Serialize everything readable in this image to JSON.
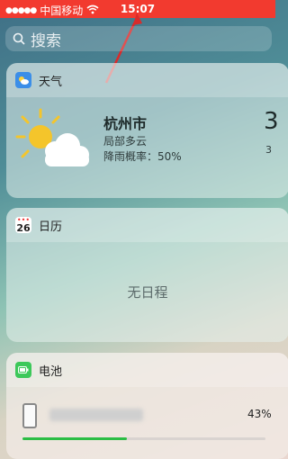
{
  "status_bar": {
    "carrier": "中国移动",
    "time": "15:07"
  },
  "search": {
    "label": "搜索"
  },
  "weather_widget": {
    "title": "天气",
    "city": "杭州市",
    "condition": "局部多云",
    "rain_chance": "降雨概率：50%",
    "temp_partial": "3",
    "temp_small_partial": "3"
  },
  "calendar_widget": {
    "title": "日历",
    "icon_date": "26",
    "empty_text": "无日程"
  },
  "battery_widget": {
    "title": "电池",
    "percent": "43%",
    "level": 0.43
  },
  "colors": {
    "status_bar": "#f23a2f",
    "battery_green": "#2bbd45"
  }
}
